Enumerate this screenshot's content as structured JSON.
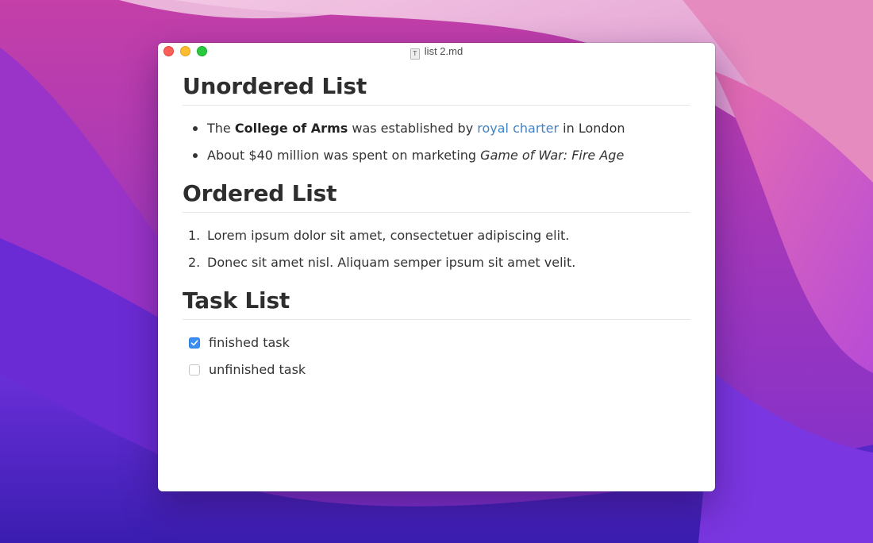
{
  "window": {
    "title": "list 2.md",
    "file_icon_letter": "T"
  },
  "sections": {
    "unordered": {
      "heading": "Unordered List",
      "item1": {
        "prefix": "The ",
        "bold": "College of Arms",
        "middle": " was established by ",
        "link": "royal charter",
        "suffix": " in London"
      },
      "item2": {
        "prefix": "About $40 million was spent on marketing ",
        "italic": "Game of War: Fire Age"
      }
    },
    "ordered": {
      "heading": "Ordered List",
      "items": [
        {
          "number": "1.",
          "text": "Lorem ipsum dolor sit amet, consectetuer adipiscing elit."
        },
        {
          "number": "2.",
          "text": "Donec sit amet nisl. Aliquam semper ipsum sit amet velit."
        }
      ]
    },
    "tasks": {
      "heading": "Task List",
      "items": [
        {
          "text": "finished task",
          "checked": true
        },
        {
          "text": "unfinished task",
          "checked": false
        }
      ]
    }
  },
  "colors": {
    "link": "#4183c4",
    "checkbox_checked": "#3b8ff2",
    "close": "#fe5f57",
    "minimize": "#febc2e",
    "maximize": "#28c840"
  }
}
